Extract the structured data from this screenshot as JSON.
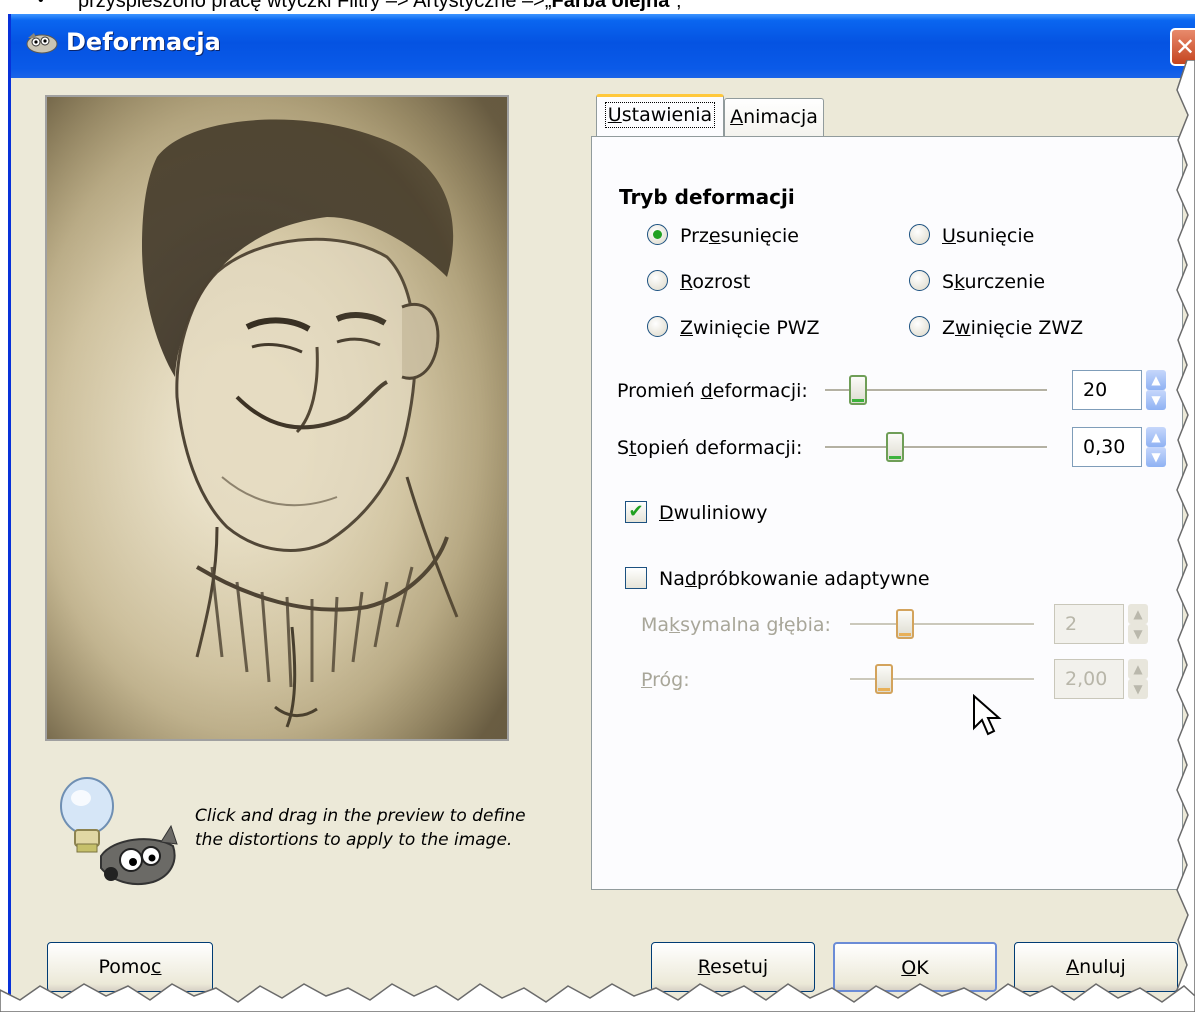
{
  "doc": {
    "bullet": "•",
    "prefix": "przyspieszono pracę wtyczki Filtry –> Artystyczne –>„",
    "bold": "Farba olejna",
    "suffix": "”;"
  },
  "window": {
    "title": "Deformacja",
    "close_glyph": "✕"
  },
  "preview": {
    "hint_line1": "Click and drag in the preview to define",
    "hint_line2": "the distortions to apply to the image."
  },
  "tabs": [
    {
      "label": "Ustawienia",
      "accesskey": "U",
      "rest": "stawienia",
      "active": true
    },
    {
      "label": "Animacja",
      "accesskey": "A",
      "rest": "nimacja",
      "active": false
    }
  ],
  "mode": {
    "title": "Tryb deformacji",
    "options": [
      {
        "pre": "Prz",
        "key": "e",
        "post": "sunięcie",
        "selected": true
      },
      {
        "pre": "",
        "key": "U",
        "post": "sunięcie",
        "selected": false
      },
      {
        "pre": "",
        "key": "R",
        "post": "ozrost",
        "selected": false
      },
      {
        "pre": "S",
        "key": "k",
        "post": "urczenie",
        "selected": false
      },
      {
        "pre": "",
        "key": "Z",
        "post": "winięcie PWZ",
        "selected": false
      },
      {
        "pre": "Z",
        "key": "w",
        "post": "inięcie ZWZ",
        "selected": false
      }
    ]
  },
  "radius": {
    "pre": "Promień ",
    "key": "d",
    "post": "eformacji:",
    "value": "20",
    "position": 0.12
  },
  "strength": {
    "pre": "S",
    "key": "t",
    "post": "opień deformacji:",
    "value": "0,30",
    "position": 0.3
  },
  "bilinear": {
    "key": "D",
    "post": "wuliniowy",
    "checked": true,
    "check_glyph": "✔"
  },
  "supersample": {
    "pre": "Na",
    "key": "d",
    "post": "próbkowanie adaptywne",
    "checked": false
  },
  "max_depth": {
    "pre": "Ma",
    "key": "k",
    "post": "symalna głębia:",
    "value": "2",
    "position": 0.28
  },
  "threshold": {
    "pre": "",
    "key": "P",
    "post": "róg:",
    "value": "2,00",
    "position": 0.15
  },
  "spin_up": "▲",
  "spin_down": "▼",
  "buttons": {
    "help": {
      "pre": "Pomo",
      "key": "c",
      "post": ""
    },
    "reset": {
      "pre": "",
      "key": "R",
      "post": "esetuj"
    },
    "ok": {
      "pre": "",
      "key": "O",
      "post": "K"
    },
    "cancel": {
      "pre": "",
      "key": "A",
      "post": "nuluj"
    }
  }
}
